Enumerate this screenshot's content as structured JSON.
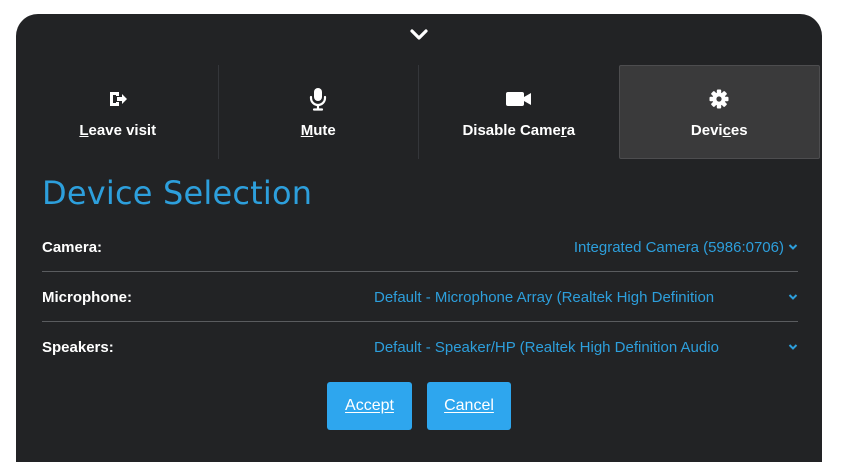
{
  "toolbar": {
    "leave": {
      "label": "Leave visit",
      "icon": "sign-out-icon"
    },
    "mute": {
      "label": "Mute",
      "icon": "microphone-icon"
    },
    "camera": {
      "label": "Disable Camera",
      "icon": "video-camera-icon"
    },
    "devices": {
      "label": "Devices",
      "icon": "gear-icon"
    }
  },
  "dialog": {
    "title": "Device Selection",
    "camera": {
      "label": "Camera:",
      "value": "Integrated Camera (5986:0706)"
    },
    "microphone": {
      "label": "Microphone:",
      "value": "Default - Microphone Array (Realtek High Definition"
    },
    "speakers": {
      "label": "Speakers:",
      "value": "Default - Speaker/HP (Realtek High Definition Audio"
    },
    "accept_label": "Accept",
    "cancel_label": "Cancel"
  },
  "colors": {
    "panel_bg": "#222325",
    "accent": "#2d9fdc",
    "button_bg": "#2ea6ee",
    "active_tab_bg": "#3a3a3b"
  }
}
